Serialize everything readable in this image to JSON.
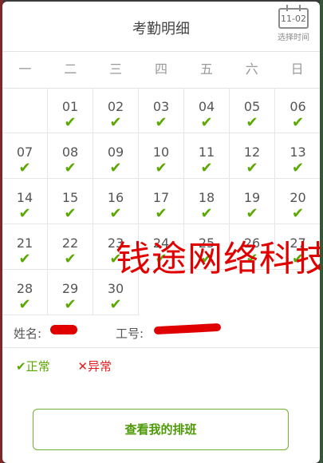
{
  "header": {
    "title": "考勤明细",
    "picker_date": "11-02",
    "picker_label": "选择时间"
  },
  "weekdays": [
    "一",
    "二",
    "三",
    "四",
    "五",
    "六",
    "日"
  ],
  "calendar": {
    "days": [
      "01",
      "02",
      "03",
      "04",
      "05",
      "06",
      "07",
      "08",
      "09",
      "10",
      "11",
      "12",
      "13",
      "14",
      "15",
      "16",
      "17",
      "18",
      "19",
      "20",
      "21",
      "22",
      "23",
      "24",
      "25",
      "26",
      "27",
      "28",
      "29",
      "30"
    ],
    "status_mark": "✔"
  },
  "info": {
    "name_label": "姓名:",
    "id_label": "工号:"
  },
  "watermark": "钱途网络科技",
  "legend": {
    "normal_icon": "✔",
    "normal_label": "正常",
    "abnormal_icon": "✕",
    "abnormal_label": "异常"
  },
  "button": {
    "label": "查看我的排班"
  },
  "colors": {
    "accent": "#5aa800",
    "danger": "#e02020"
  }
}
